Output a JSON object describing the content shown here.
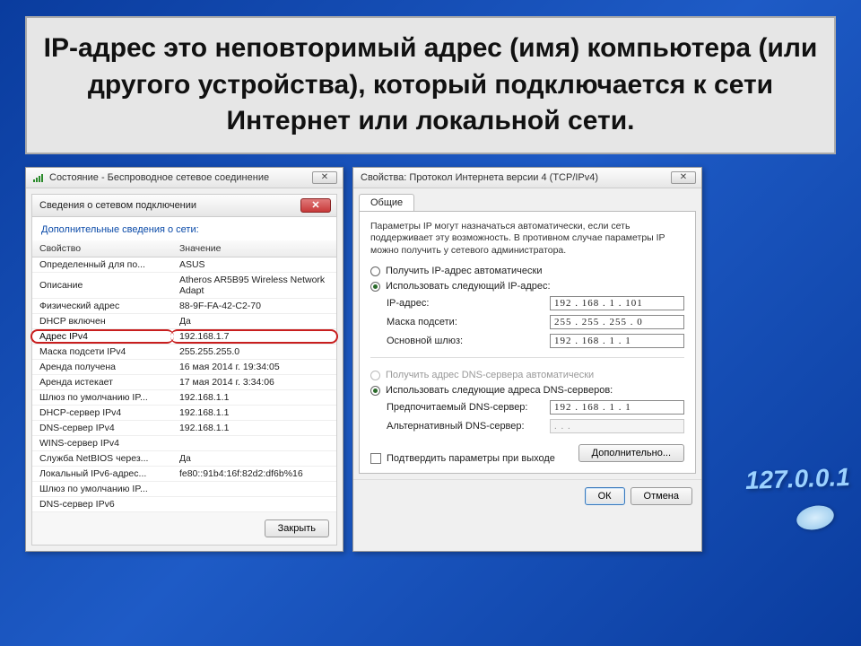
{
  "title": "IP-адрес это неповторимый адрес (имя) компьютера (или другого устройства), который подключается к сети Интернет или локальной сети.",
  "left": {
    "outer_title": "Состояние - Беспроводное сетевое соединение",
    "inner_title": "Сведения о сетевом подключении",
    "section": "Дополнительные сведения о сети:",
    "col_prop": "Свойство",
    "col_val": "Значение",
    "rows": [
      {
        "p": "Определенный для по...",
        "v": "ASUS"
      },
      {
        "p": "Описание",
        "v": "Atheros AR5B95 Wireless Network Adapt"
      },
      {
        "p": "Физический адрес",
        "v": "88-9F-FA-42-C2-70"
      },
      {
        "p": "DHCP включен",
        "v": "Да"
      },
      {
        "p": "Адрес IPv4",
        "v": "192.168.1.7",
        "hl": true
      },
      {
        "p": "Маска подсети IPv4",
        "v": "255.255.255.0"
      },
      {
        "p": "Аренда получена",
        "v": "16 мая 2014 г. 19:34:05"
      },
      {
        "p": "Аренда истекает",
        "v": "17 мая 2014 г. 3:34:06"
      },
      {
        "p": "Шлюз по умолчанию IP...",
        "v": "192.168.1.1"
      },
      {
        "p": "DHCP-сервер IPv4",
        "v": "192.168.1.1"
      },
      {
        "p": "DNS-сервер IPv4",
        "v": "192.168.1.1"
      },
      {
        "p": "WINS-сервер IPv4",
        "v": ""
      },
      {
        "p": "Служба NetBIOS через...",
        "v": "Да"
      },
      {
        "p": "Локальный IPv6-адрес...",
        "v": "fe80::91b4:16f:82d2:df6b%16"
      },
      {
        "p": "Шлюз по умолчанию IP...",
        "v": ""
      },
      {
        "p": "DNS-сервер IPv6",
        "v": ""
      }
    ],
    "close_btn": "Закрыть"
  },
  "right": {
    "title": "Свойства: Протокол Интернета версии 4 (TCP/IPv4)",
    "tab": "Общие",
    "desc": "Параметры IP могут назначаться автоматически, если сеть поддерживает эту возможность. В противном случае параметры IP можно получить у сетевого администратора.",
    "r_auto": "Получить IP-адрес автоматически",
    "r_manual": "Использовать следующий IP-адрес:",
    "f_ip": "IP-адрес:",
    "f_mask": "Маска подсети:",
    "f_gw": "Основной шлюз:",
    "v_ip": "192 . 168 .  1  . 101",
    "v_mask": "255 . 255 . 255 .  0",
    "v_gw": "192 . 168 .  1  .  1",
    "r_dns_auto": "Получить адрес DNS-сервера автоматически",
    "r_dns_manual": "Использовать следующие адреса DNS-серверов:",
    "f_dns1": "Предпочитаемый DNS-сервер:",
    "f_dns2": "Альтернативный DNS-сервер:",
    "v_dns1": "192 . 168 .  1  .  1",
    "v_dns2": " .       .       .",
    "chk": "Подтвердить параметры при выходе",
    "adv": "Дополнительно...",
    "ok": "ОК",
    "cancel": "Отмена"
  },
  "deco": "127.0.0.1"
}
